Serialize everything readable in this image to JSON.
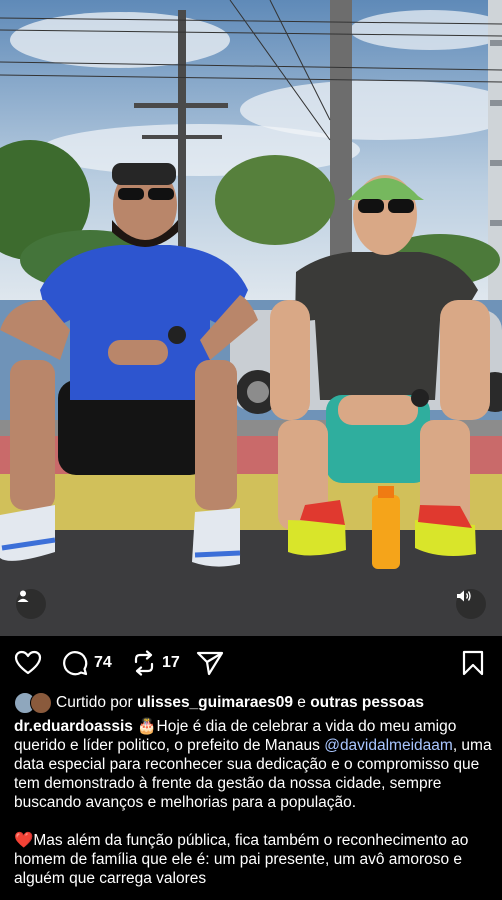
{
  "post": {
    "comment_count": "74",
    "repost_count": "17"
  },
  "likes": {
    "prefix": "Curtido por",
    "user": "ulisses_guimaraes09",
    "conjunction": "e",
    "others": "outras pessoas"
  },
  "caption": {
    "username": "dr.eduardoassis",
    "cake_emoji": "🎂",
    "text_1": "Hoje é dia de celebrar a vida do meu amigo querido e líder politico, o prefeito de Manaus",
    "mention": "@davidalmeidaam",
    "text_2": ", uma  data especial para reconhecer sua dedicação e o compromisso que tem demonstrado à frente da gestão da nossa cidade, sempre buscando avanços e melhorias para a população.",
    "heart_emoji": "❤️",
    "text_3": "Mas além da função pública, fica também o reconhecimento ao homem de família que ele é: um pai presente, um avô amoroso e alguém que carrega valores"
  },
  "icons": {
    "like": "heart-icon",
    "comment": "comment-icon",
    "repost": "repost-icon",
    "share": "send-icon",
    "save": "bookmark-icon",
    "tags": "person-icon",
    "audio": "speaker-icon"
  },
  "colors": {
    "background": "#000000",
    "mention": "#a9c6ff"
  }
}
